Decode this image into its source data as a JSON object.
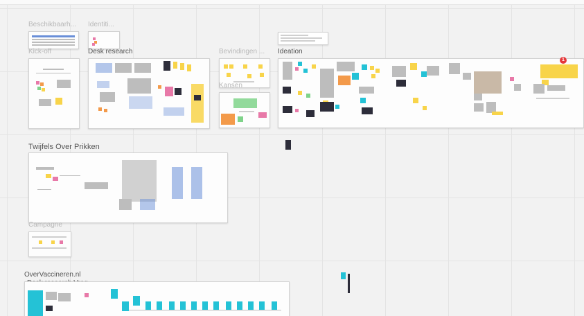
{
  "frames": {
    "beschikbaarheid": "Beschikbaarh...",
    "identiteit": "Identiti...",
    "kickoff": "Kick-off",
    "desk_research": "Desk research",
    "bevindingen": "Bevindingen ...",
    "kansen": "Kansen",
    "ideation": "Ideation",
    "twijfels": "Twijfels Over Prikken",
    "campagne": "Campagne",
    "overvaccineren": "OverVaccineren.nl",
    "desk_research_vragen": "Desk research Vrag..."
  },
  "notification_count": "1",
  "colors": {
    "canvas": "#f2f2f2",
    "sticky_yellow": "#f8d44a",
    "sticky_orange": "#f39a4a",
    "sticky_pink": "#e879a8",
    "sticky_green": "#7fd38a",
    "accent_cyan": "#24c2d6",
    "badge_red": "#e5383b"
  }
}
